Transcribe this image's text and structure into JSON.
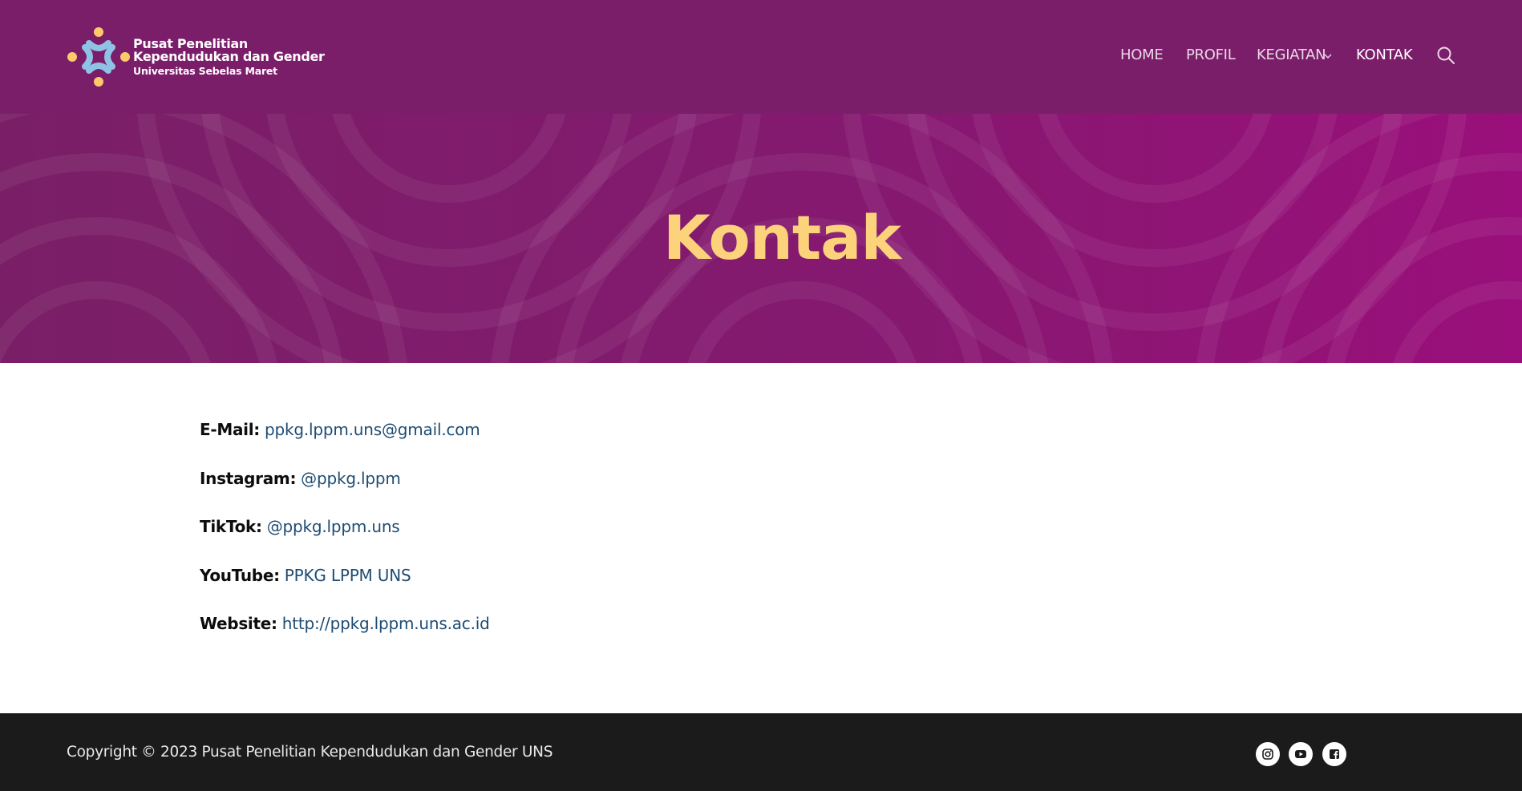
{
  "header": {
    "logo": {
      "line1": "Pusat Penelitian",
      "line2": "Kependudukan dan Gender",
      "line3": "Universitas Sebelas Maret"
    },
    "nav": [
      {
        "label": "HOME",
        "active": false
      },
      {
        "label": "PROFIL",
        "active": false
      },
      {
        "label": "KEGIATAN",
        "active": false,
        "has_dropdown": true
      },
      {
        "label": "KONTAK",
        "active": true
      }
    ],
    "search_icon": "search-icon"
  },
  "hero": {
    "title": "Kontak"
  },
  "contacts": [
    {
      "label": "E-Mail:",
      "value": "ppkg.lppm.uns@gmail.com"
    },
    {
      "label": "Instagram:",
      "value": "@ppkg.lppm"
    },
    {
      "label": "TikTok:",
      "value": "@ppkg.lppm.uns"
    },
    {
      "label": "YouTube:",
      "value": "PPKG LPPM UNS"
    },
    {
      "label": "Website:",
      "value": "http://ppkg.lppm.uns.ac.id"
    }
  ],
  "footer": {
    "copyright": "Copyright © 2023 Pusat Penelitian Kependudukan dan Gender UNS",
    "social_icons": [
      "instagram-icon",
      "youtube-icon",
      "facebook-icon"
    ]
  },
  "colors": {
    "header_bg": "#7b1e6a",
    "hero_title": "#fcd27b",
    "link": "#1e4c73",
    "footer_bg": "#1b1b1b"
  }
}
